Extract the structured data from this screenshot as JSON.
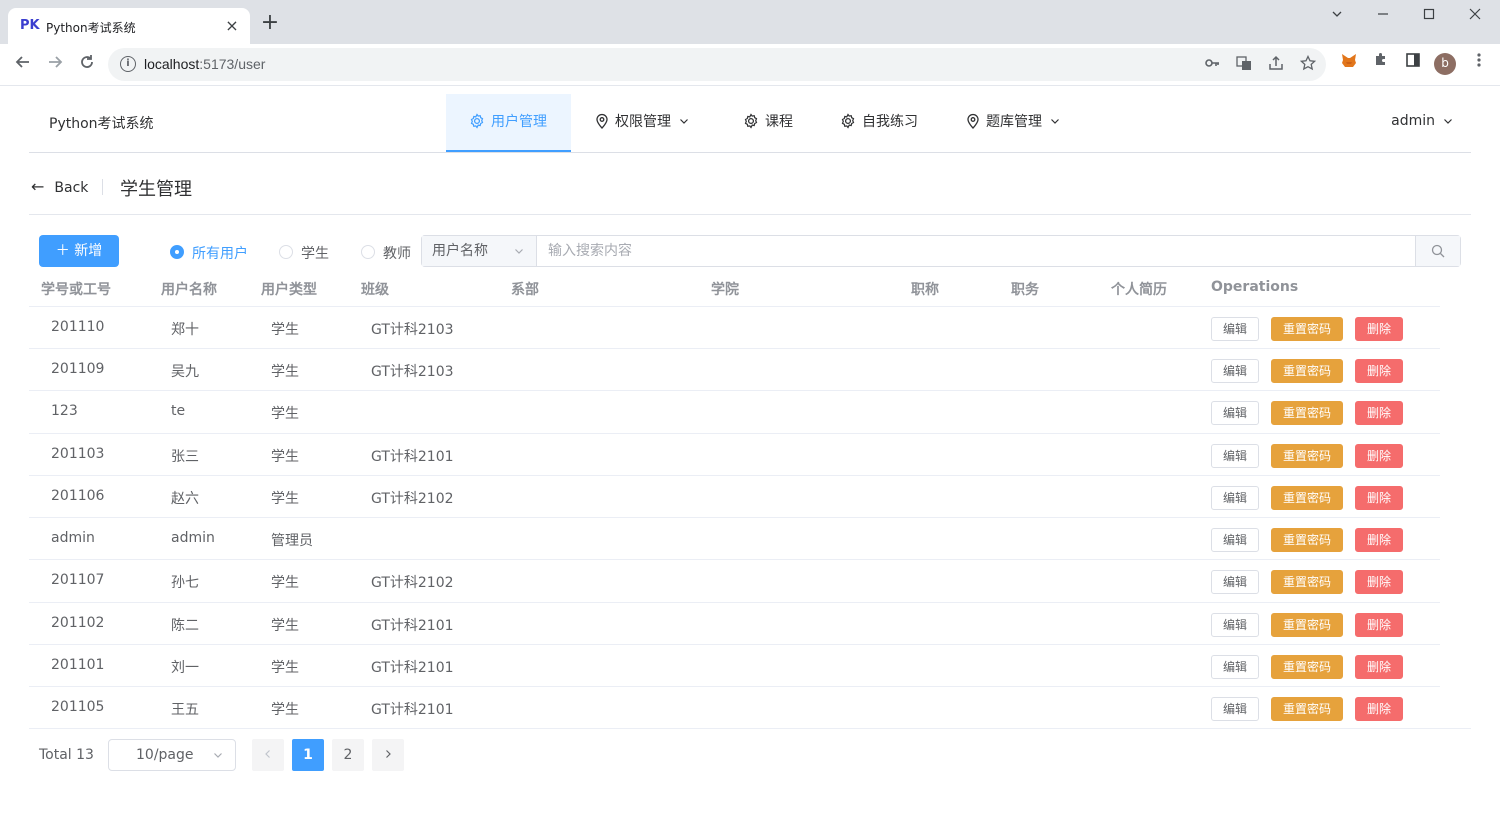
{
  "browser": {
    "tab_favicon": "PK",
    "tab_title": "Python考试系统",
    "url_host": "localhost",
    "url_rest": ":5173/user",
    "avatar_letter": "b"
  },
  "header": {
    "app_title": "Python考试系统",
    "menu": [
      {
        "label": "用户管理",
        "icon": "gear-icon",
        "active": true
      },
      {
        "label": "权限管理",
        "icon": "location-icon",
        "dropdown": true
      },
      {
        "label": "课程",
        "icon": "gear-icon"
      },
      {
        "label": "自我练习",
        "icon": "gear-icon"
      },
      {
        "label": "题库管理",
        "icon": "location-icon",
        "dropdown": true
      }
    ],
    "user": "admin"
  },
  "page_header": {
    "back_label": "Back",
    "title": "学生管理"
  },
  "toolbar": {
    "add_label": "新增",
    "radios": [
      {
        "label": "所有用户",
        "checked": true
      },
      {
        "label": "学生",
        "checked": false
      },
      {
        "label": "教师",
        "checked": false
      }
    ],
    "search_field": "用户名称",
    "search_placeholder": "输入搜索内容"
  },
  "table": {
    "columns": [
      "学号或工号",
      "用户名称",
      "用户类型",
      "班级",
      "系部",
      "学院",
      "职称",
      "职务",
      "个人简历",
      "Operations"
    ],
    "actions": {
      "edit": "编辑",
      "reset": "重置密码",
      "delete": "删除"
    },
    "rows": [
      {
        "id": "201110",
        "name": "郑十",
        "type": "学生",
        "class": "GT计科2103"
      },
      {
        "id": "201109",
        "name": "吴九",
        "type": "学生",
        "class": "GT计科2103"
      },
      {
        "id": "123",
        "name": "te",
        "type": "学生",
        "class": ""
      },
      {
        "id": "201103",
        "name": "张三",
        "type": "学生",
        "class": "GT计科2101"
      },
      {
        "id": "201106",
        "name": "赵六",
        "type": "学生",
        "class": "GT计科2102"
      },
      {
        "id": "admin",
        "name": "admin",
        "type": "管理员",
        "class": ""
      },
      {
        "id": "201107",
        "name": "孙七",
        "type": "学生",
        "class": "GT计科2102"
      },
      {
        "id": "201102",
        "name": "陈二",
        "type": "学生",
        "class": "GT计科2101"
      },
      {
        "id": "201101",
        "name": "刘一",
        "type": "学生",
        "class": "GT计科2101"
      },
      {
        "id": "201105",
        "name": "王五",
        "type": "学生",
        "class": "GT计科2101"
      }
    ]
  },
  "pagination": {
    "total_label": "Total 13",
    "page_size": "10/page",
    "pages": [
      "1",
      "2"
    ],
    "current_page": "1"
  },
  "colors": {
    "primary": "#409eff",
    "warning": "#e6a23c",
    "danger": "#f56c6c"
  }
}
